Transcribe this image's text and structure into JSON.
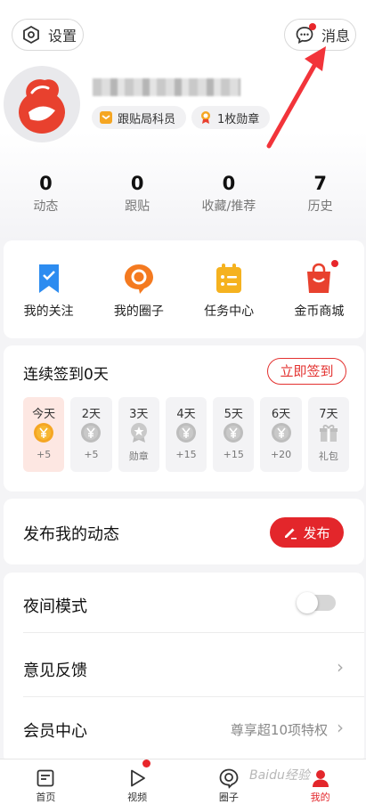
{
  "header": {
    "settings_label": "设置",
    "messages_label": "消息"
  },
  "profile": {
    "rank_badge": "跟贴局科员",
    "medal_badge": "1枚勋章"
  },
  "stats": [
    {
      "value": "0",
      "label": "动态"
    },
    {
      "value": "0",
      "label": "跟贴"
    },
    {
      "value": "0",
      "label": "收藏/推荐"
    },
    {
      "value": "7",
      "label": "历史"
    }
  ],
  "shortcuts": [
    {
      "label": "我的关注",
      "icon": "bookmark-icon"
    },
    {
      "label": "我的圈子",
      "icon": "circle-chat-icon"
    },
    {
      "label": "任务中心",
      "icon": "task-clipboard-icon"
    },
    {
      "label": "金币商城",
      "icon": "shopping-bag-icon"
    }
  ],
  "signin": {
    "title": "连续签到0天",
    "button": "立即签到",
    "days": [
      {
        "label": "今天",
        "reward": "+5"
      },
      {
        "label": "2天",
        "reward": "+5"
      },
      {
        "label": "3天",
        "reward": "勋章"
      },
      {
        "label": "4天",
        "reward": "+15"
      },
      {
        "label": "5天",
        "reward": "+15"
      },
      {
        "label": "6天",
        "reward": "+20"
      },
      {
        "label": "7天",
        "reward": "礼包"
      }
    ]
  },
  "publish": {
    "title": "发布我的动态",
    "button": "发布"
  },
  "list": {
    "night_mode": "夜间模式",
    "feedback": "意见反馈",
    "vip_center": "会员中心",
    "vip_sub": "尊享超10项特权"
  },
  "bottom_nav": [
    {
      "label": "首页"
    },
    {
      "label": "视频"
    },
    {
      "label": "圈子"
    },
    {
      "label": "我的"
    }
  ],
  "watermark": "Baidu经验",
  "colors": {
    "accent": "#e3262b",
    "badge_bg": "#f1f1f3",
    "today_bg": "#fde7e2"
  }
}
